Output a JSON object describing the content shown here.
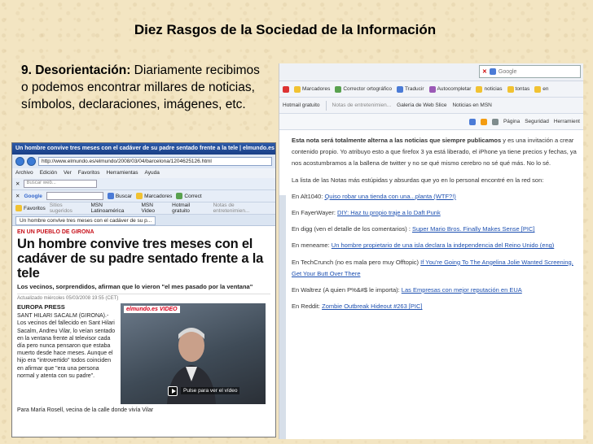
{
  "slide": {
    "title": "Diez Rasgos de la Sociedad de la Información",
    "point_label": "9. Desorientación:",
    "point_text": " Diariamente recibimos o podemos encontrar millares de noticias, símbolos, declaraciones, imágenes, etc."
  },
  "left_shot": {
    "window_title": "Un hombre convive tres meses con el cadáver de su padre sentado frente a la tele | elmundo.es - Windows Internet Explorer",
    "url": "http://www.elmundo.es/elmundo/2008/03/04/barcelona/1204625126.html",
    "menu": [
      "Archivo",
      "Edición",
      "Ver",
      "Favoritos",
      "Herramientas",
      "Ayuda"
    ],
    "search_placeholder": "Buscar web...",
    "google_label": "Google",
    "toolbar_search": "Buscar",
    "toolbar_bookmarks": "Marcadores",
    "toolbar_correct": "Correct",
    "favorites_label": "Favoritos",
    "favorites_items": [
      "Sitios sugeridos",
      "MSN Latinoamérica",
      "MSN Video",
      "Hotmail gratuito",
      "Notas de entretenimien..."
    ],
    "tab_label": "Un hombre convive tres meses con el cadáver de su p...",
    "news": {
      "kicker": "EN UN PUEBLO DE GIRONA",
      "headline": "Un hombre convive tres meses con el cadáver de su padre sentado frente a la tele",
      "subheadline": "Los vecinos, sorprendidos, afirman que lo vieron \"el mes pasado por la ventana\"",
      "meta": "Actualizado miércoles 05/03/2008 19:55 (CET)",
      "source": "EUROPA PRESS",
      "body": "SANT HILARI SACALM (GIRONA).- Los vecinos del fallecido en Sant Hilari Sacalm, Andreu Vilar, lo veían sentado en la ventana frente al televisor cada día pero nunca pensaron que estaba muerto desde hace meses. Aunque el hijo era \"introvertido\" todos coinciden en afirmar que \"era una persona normal y atenta con su padre\".",
      "video_brand": "elmundo.es VIDEO",
      "video_caption": "Pulse para ver el vídeo",
      "footer": "Para María Rosell, vecina de la calle donde vivía Vilar"
    }
  },
  "right_shot": {
    "search_placeholder": "Google",
    "toolbar": [
      "Marcadores",
      "Corrector ortográfico",
      "Traducir",
      "Autocompletar",
      "noticias",
      "tontas",
      "en"
    ],
    "links": [
      "Hotmail gratuito",
      "Notas de entretenimien...",
      "Galería de Web Slice",
      "Noticias en MSN"
    ],
    "cmdbar": [
      "Página",
      "Seguridad",
      "Herramient"
    ],
    "paragraphs": [
      {
        "pre": "Esta nota será totalmente alterna a las noticias que siempre publicamos",
        "link": "",
        "post": " y es una invitación a crear contenido propio. Yo atribuyo esto a que firefox 3 ya está liberado, el iPhone ya tiene precios y fechas, ya nos acostumbramos a la ballena de twitter y no se qué mismo cerebro no sé qué más. No lo sé."
      },
      {
        "pre": "La lista de las Notas más estúpidas y absurdas que yo en lo personal encontré en la red son:",
        "link": "",
        "post": ""
      },
      {
        "pre": "En Alt1040: ",
        "link": "Quiso robar una tienda con una...planta (WTF?!)",
        "post": ""
      },
      {
        "pre": "En FayerWayer: ",
        "link": "DIY: Haz tu propio traje a lo Daft Punk",
        "post": ""
      },
      {
        "pre": "En digg (ven el detalle de los comentarios) : ",
        "link": "Super Mario Bros. Finally Makes Sense [PIC]",
        "post": ""
      },
      {
        "pre": "En meneame: ",
        "link": "Un hombre propietario de una isla declara la independencia del Reino Unido (eng)",
        "post": ""
      },
      {
        "pre": "En TechCrunch (no es mala pero muy Offtopic) ",
        "link": "If You're Going To The Angelina Jolie Wanted Screening, Get Your Butt Over There",
        "post": ""
      },
      {
        "pre": "En Waltrez (A quien P%&#$ le importa): ",
        "link": "Las Empresas con mejor reputación en EUA",
        "post": ""
      },
      {
        "pre": "En Reddit: ",
        "link": "Zombie Outbreak Hideout #263 [PIC]",
        "post": ""
      }
    ]
  },
  "colors": {
    "background": "#f3e5c2",
    "ie_titlebar": "#1a3f86",
    "news_red": "#c8101a",
    "link_blue": "#1c4fb0"
  }
}
